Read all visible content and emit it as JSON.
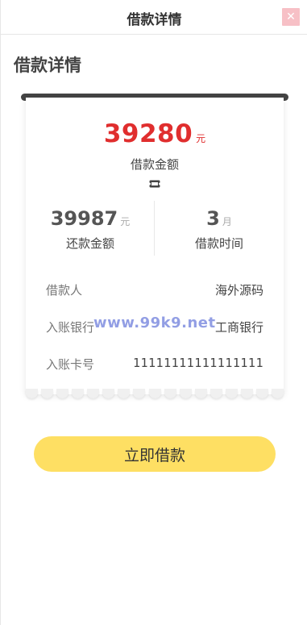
{
  "header": {
    "title": "借款详情",
    "close_icon": "close-icon",
    "close_color": "#f7c0c6"
  },
  "page": {
    "title": "借款详情"
  },
  "receipt": {
    "loan_amount": "39280",
    "loan_unit": "元",
    "loan_label": "借款金额",
    "ticket_icon": "ticket-icon",
    "repay_amount": "39987",
    "repay_unit": "元",
    "repay_label": "还款金额",
    "term": "3",
    "term_unit": "月",
    "term_label": "借款时间",
    "rows": [
      {
        "key": "借款人",
        "value": "海外源码"
      },
      {
        "key": "入账银行",
        "value": "工商银行"
      },
      {
        "key": "入账卡号",
        "value": "11111111111111111"
      }
    ],
    "accent_color": "#e02e2e"
  },
  "watermark": "www.99k9.net",
  "cta": {
    "label": "立即借款",
    "color": "#fedf63"
  }
}
